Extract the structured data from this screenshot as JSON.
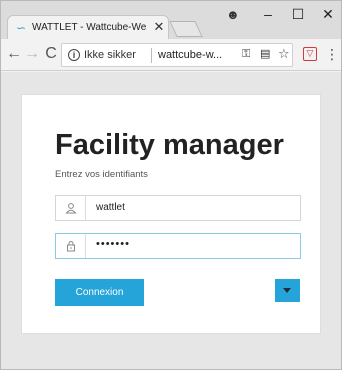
{
  "browser": {
    "tab": {
      "title": "WATTLET - Wattcube-We",
      "favicon": "wattlet-logo-icon",
      "close_glyph": "✕"
    },
    "window_controls": {
      "minimize": "–",
      "maximize": "☐",
      "close": "✕"
    },
    "profile_glyph": "●",
    "nav": {
      "back": "←",
      "forward": "→",
      "reload": "C"
    },
    "omnibox": {
      "info_glyph": "i",
      "security_label": "Ikke sikker",
      "url": "wattcube-w..."
    },
    "icons": {
      "key": "key-icon",
      "translate": "translate-icon",
      "star": "star-icon",
      "extension": "extension-icon",
      "menu": "menu-icon"
    }
  },
  "login": {
    "title": "Facility manager",
    "subtitle": "Entrez vos identifiants",
    "username": {
      "value": "wattlet",
      "icon": "user-icon"
    },
    "password": {
      "value": "•••••••",
      "icon": "lock-icon"
    },
    "connect_label": "Connexion"
  },
  "colors": {
    "primary_button": "#24a4d8",
    "focused_border": "#8ccbe6"
  }
}
